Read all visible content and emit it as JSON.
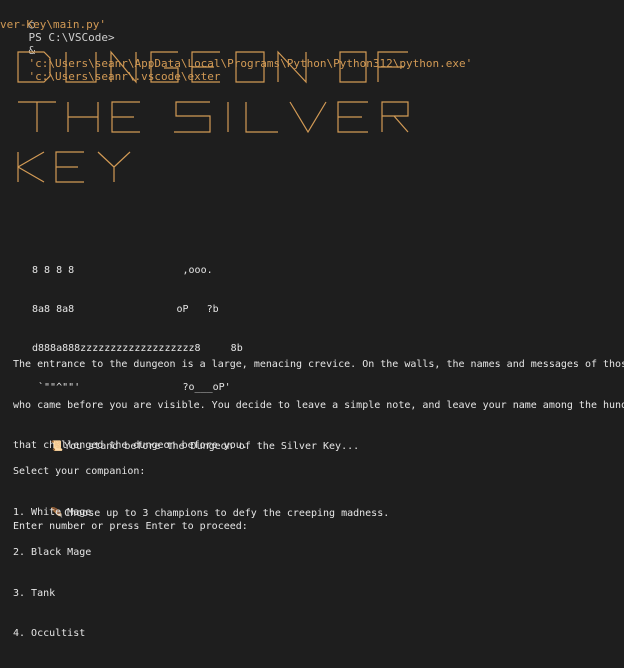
{
  "command": {
    "marker": "○",
    "prompt": "PS C:\\VSCode>",
    "amp": "&",
    "python_exe": "'c:\\Users\\seanr\\AppData\\Local\\Programs\\Python\\Python312\\python.exe'",
    "script_path_start": "'c:\\Users\\seanr\\.vscode\\exter",
    "script_path_end": "ver-Key\\main.py'"
  },
  "banner": {
    "lines": [
      "DUNGEON OF",
      "THE SILVER",
      "KEY"
    ],
    "color": "#d29a55"
  },
  "key_art": {
    "lines": [
      "8 8 8 8                  ,ooo.",
      "8a8 8a8                 oP   ?b",
      "d888a888zzzzzzzzzzzzzzzzzzz8     8b",
      " `\"\"^\"\"'                 ?o___oP'"
    ]
  },
  "intro": {
    "lines": [
      "The entrance to the dungeon is a large, menacing crevice. On the walls, the names and messages of those",
      "who came before you are visible. You decide to leave a simple note, and leave your name among the hundreds",
      "that challenged the dungeon before you."
    ]
  },
  "story": {
    "line1_icon": "scroll-icon",
    "line1": "You stand before the Dungeon of the Silver Key...",
    "line2_icon": "feather-icon",
    "line2": "Choose up to 3 champions to defy the creeping madness."
  },
  "companions": {
    "heading": "Select your companion:",
    "options": [
      "1. White Mage",
      "2. Black Mage",
      "3. Tank",
      "4. Occultist"
    ]
  },
  "prompt_text": "Enter number or press Enter to proceed:"
}
